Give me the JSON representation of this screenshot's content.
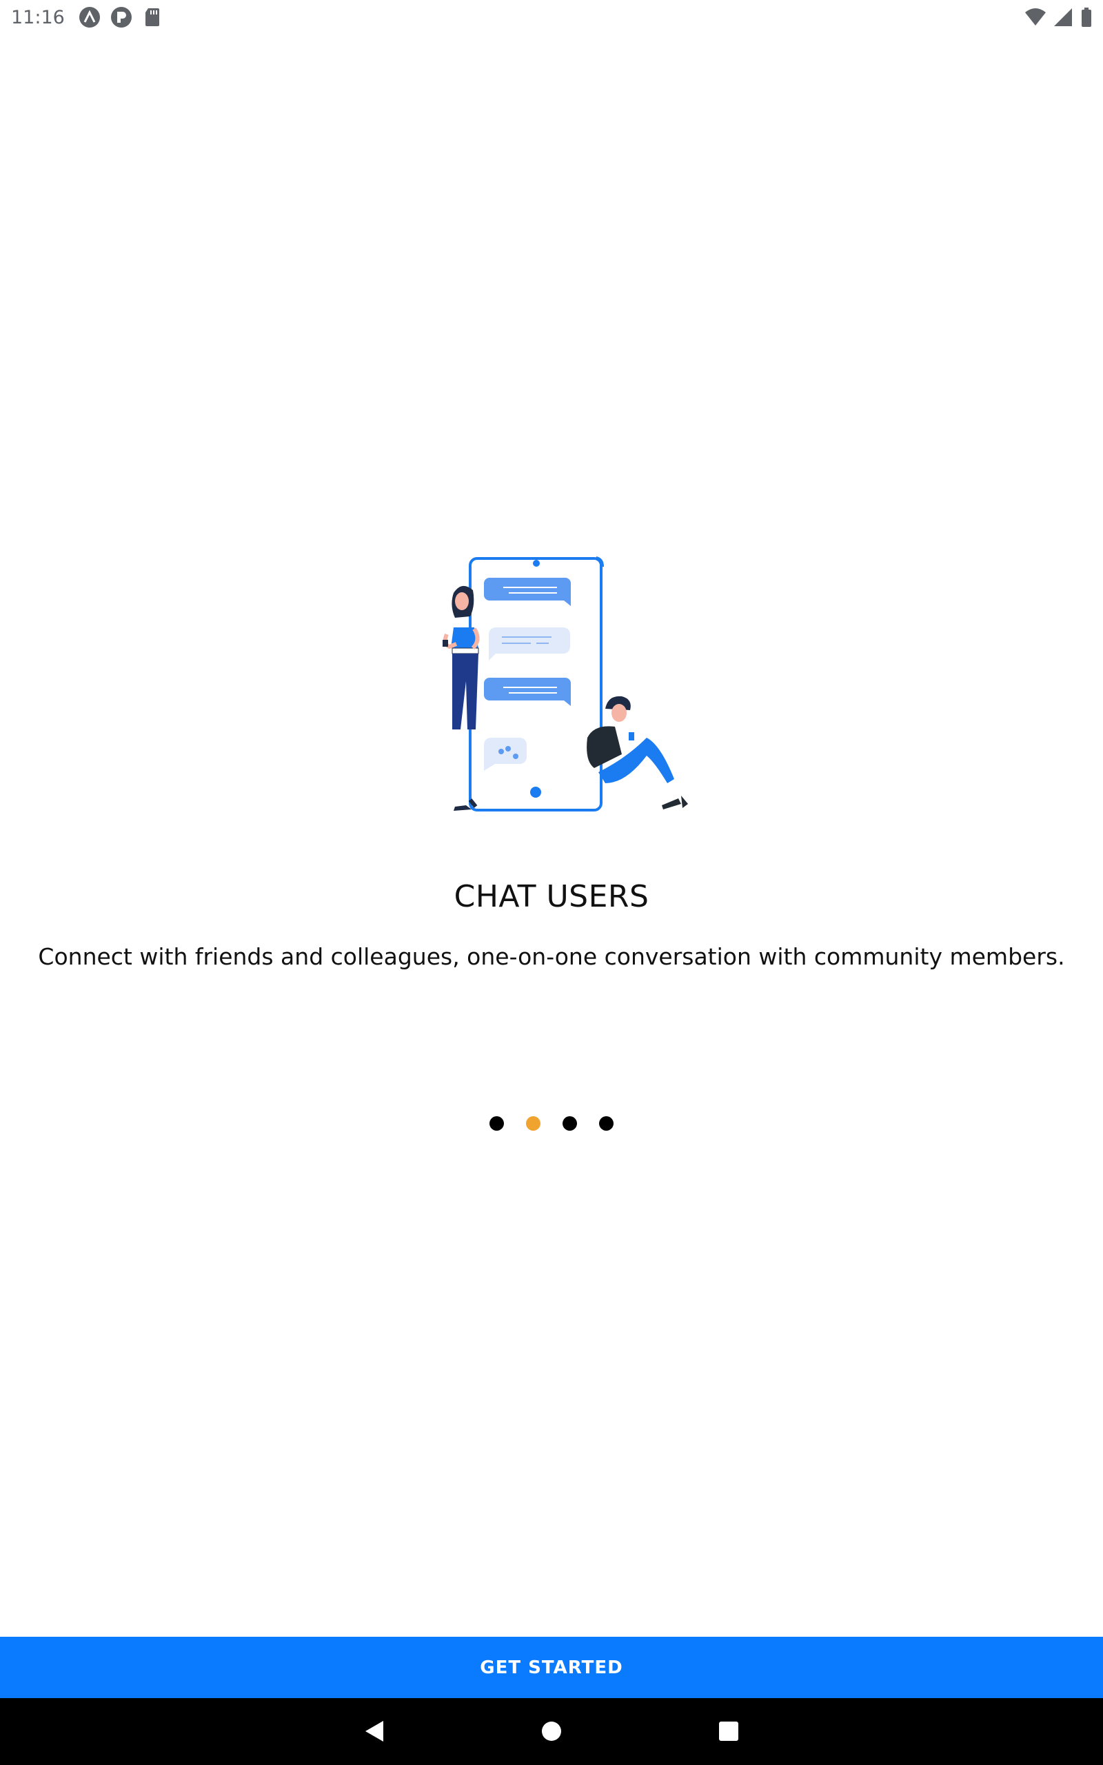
{
  "status_bar": {
    "time": "11:16",
    "left_icons": [
      "app-icon-a",
      "app-icon-p",
      "sd-card-icon"
    ],
    "right_icons": [
      "wifi-icon",
      "signal-icon",
      "battery-icon"
    ]
  },
  "onboarding": {
    "title": "CHAT USERS",
    "description": "Connect with friends and colleagues, one-on-one conversation with community members.",
    "page_indicator": {
      "count": 4,
      "active_index": 1,
      "active_color": "#f0a32f",
      "inactive_color": "#000000"
    }
  },
  "actions": {
    "get_started_label": "GET STARTED",
    "accent_color": "#0a7bff"
  },
  "nav_bar": {
    "icons": [
      "back-icon",
      "home-icon",
      "recents-icon"
    ]
  }
}
